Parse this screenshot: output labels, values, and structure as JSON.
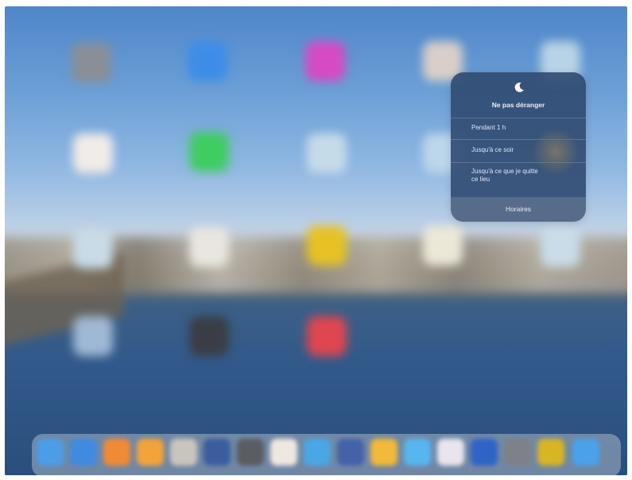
{
  "dnd": {
    "title": "Ne pas déranger",
    "options": [
      {
        "label": "Pendant 1 h"
      },
      {
        "label": "Jusqu'à ce soir"
      },
      {
        "label": "Jusqu'à ce que je quitte ce lieu"
      }
    ],
    "schedule_label": "Horaires",
    "icons": {
      "header": "moon-icon"
    }
  },
  "home_icons": [
    "settings-app-icon",
    "app-store-icon",
    "itunes-store-icon",
    "photos-app-icon",
    "maps-app-icon",
    "calendar-app-icon",
    "facetime-app-icon",
    "maps-app-icon-2",
    "weather-app-icon",
    "photos-widget-icon",
    "notes-app-icon",
    "yellow-app-icon",
    "reminders-app-icon",
    "maps-app-icon-3",
    "folder-icon",
    "camera-app-icon",
    "music-app-icon"
  ],
  "dock_icons": [
    "safari-icon",
    "mail-icon",
    "pages-icon",
    "books-icon",
    "contacts-icon",
    "facebook-icon",
    "camera-icon",
    "photos-icon",
    "weather-icon",
    "app-icon",
    "notes-icon",
    "messages-icon",
    "news-icon",
    "files-icon",
    "settings-icon",
    "yellow-app-icon",
    "app-store-icon"
  ],
  "colors": {
    "panel_bg": "#304a70",
    "panel_text": "#e8eef6"
  }
}
